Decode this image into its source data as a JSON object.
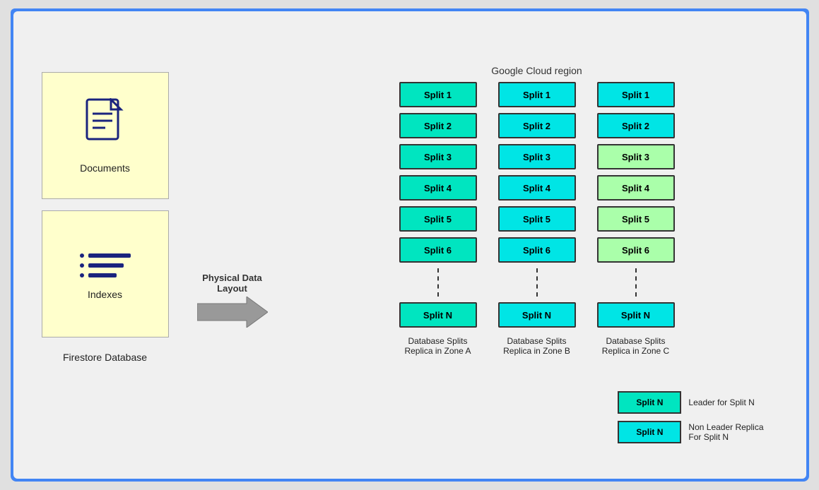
{
  "brand": {
    "google": "Google",
    "cloud": "Cloud"
  },
  "region_label": "Google Cloud region",
  "firestore_title": "Firestore Database",
  "documents_label": "Documents",
  "indexes_label": "Indexes",
  "arrow_label": "Physical Data\nLayout",
  "zones": [
    {
      "id": "zone-a",
      "splits": [
        "Split 1",
        "Split 2",
        "Split 3",
        "Split 4",
        "Split 5",
        "Split 6",
        "Split N"
      ],
      "label": "Database Splits\nReplica in Zone A",
      "colors": [
        "green",
        "green",
        "green",
        "green",
        "green",
        "green",
        "green"
      ]
    },
    {
      "id": "zone-b",
      "splits": [
        "Split 1",
        "Split 2",
        "Split 3",
        "Split 4",
        "Split 5",
        "Split 6",
        "Split N"
      ],
      "label": "Database Splits\nReplica in Zone B",
      "colors": [
        "cyan",
        "cyan",
        "cyan",
        "cyan",
        "cyan",
        "cyan",
        "cyan"
      ]
    },
    {
      "id": "zone-c",
      "splits": [
        "Split 1",
        "Split 2",
        "Split 3",
        "Split 4",
        "Split 5",
        "Split 6",
        "Split N"
      ],
      "label": "Database Splits\nReplica in Zone C",
      "colors": [
        "cyan",
        "cyan",
        "light-green",
        "light-green",
        "light-green",
        "light-green",
        "cyan"
      ]
    }
  ],
  "legend": [
    {
      "id": "leader",
      "box_label": "Split N",
      "box_color": "green",
      "description": "Leader for Split N"
    },
    {
      "id": "non-leader",
      "box_label": "Split N",
      "box_color": "cyan",
      "description": "Non Leader Replica\nFor Split N"
    }
  ]
}
